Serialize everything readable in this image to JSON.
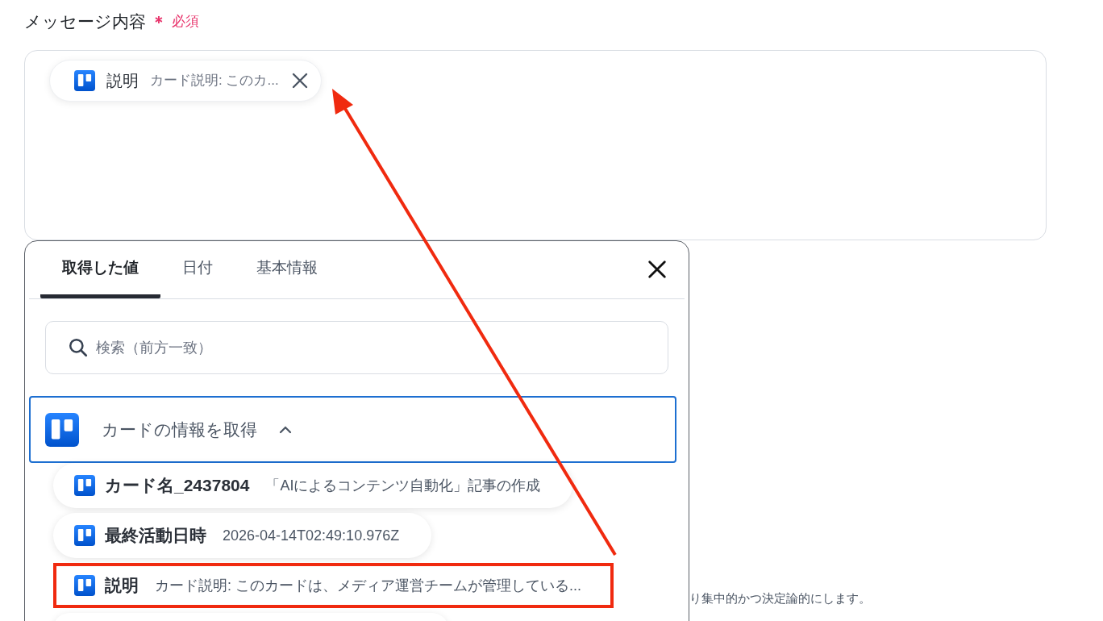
{
  "field": {
    "label": "メッセージ内容",
    "required_mark": "＊",
    "required_text": "必須",
    "tokens": [
      {
        "name": "説明",
        "value": "カード説明: このカ..."
      }
    ]
  },
  "picker": {
    "tabs": [
      {
        "label": "取得した値",
        "selected": true
      },
      {
        "label": "日付",
        "selected": false
      },
      {
        "label": "基本情報",
        "selected": false
      }
    ],
    "search": {
      "placeholder": "検索（前方一致）"
    },
    "group": {
      "title": "カードの情報を取得",
      "expanded": true,
      "items": [
        {
          "name": "カード名_2437804",
          "value": "「AIによるコンテンツ自動化」記事の作成",
          "highlighted": false
        },
        {
          "name": "最終活動日時",
          "value": "2026-04-14T02:49:10.976Z",
          "highlighted": false
        },
        {
          "name": "説明",
          "value": "カード説明: このカードは、メディア運営チームが管理している...",
          "highlighted": true
        }
      ]
    }
  },
  "background_text": "り集中的かつ決定論的にします。"
}
